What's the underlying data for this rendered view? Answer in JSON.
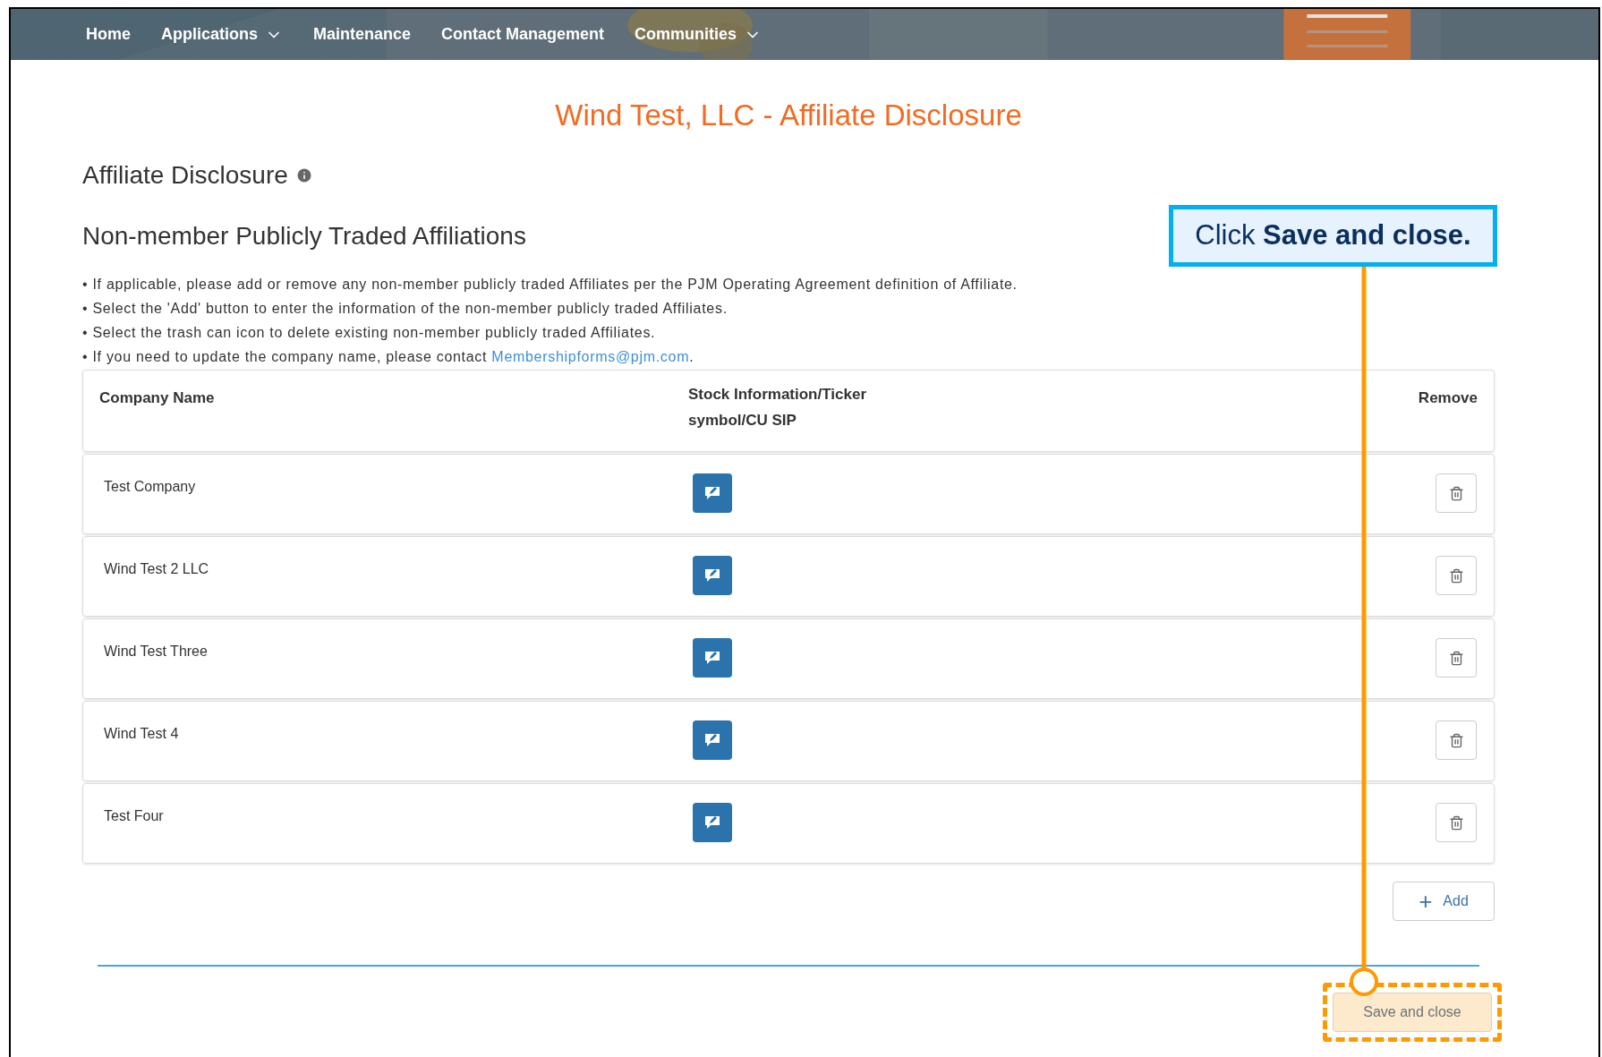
{
  "nav": {
    "items": [
      {
        "label": "Home",
        "dropdown": false
      },
      {
        "label": "Applications",
        "dropdown": true
      },
      {
        "label": "Maintenance",
        "dropdown": false
      },
      {
        "label": "Contact Management",
        "dropdown": false
      },
      {
        "label": "Communities",
        "dropdown": true
      }
    ]
  },
  "page_title": "Wind Test, LLC - Affiliate Disclosure",
  "section_title": "Affiliate Disclosure",
  "subsection_title": "Non-member Publicly Traded Affiliations",
  "bullets": [
    {
      "text": "If applicable, please add or remove any non-member publicly traded Affiliates per the PJM Operating Agreement definition of Affiliate."
    },
    {
      "text": "Select the 'Add' button to enter the information of the non-member publicly traded Affiliates."
    },
    {
      "text": "Select the trash can icon to delete existing non-member publicly traded Affiliates."
    },
    {
      "text": "If you need to update the company name, please contact ",
      "link": "Membershipforms@pjm.com",
      "after": "."
    }
  ],
  "bullet_mark": "•",
  "table": {
    "columns": [
      "Company Name",
      "Stock Information/Ticker symbol/CU SIP",
      "Remove"
    ],
    "rows": [
      {
        "company": "Test Company"
      },
      {
        "company": "Wind Test 2 LLC"
      },
      {
        "company": "Wind Test Three"
      },
      {
        "company": "Wind Test 4"
      },
      {
        "company": "Test Four"
      }
    ]
  },
  "add_button": {
    "icon": "+",
    "label": "Add"
  },
  "save_button": {
    "label": "Save and close",
    "highlighted": true
  },
  "callout": {
    "text": "Click **Save and close.**"
  }
}
